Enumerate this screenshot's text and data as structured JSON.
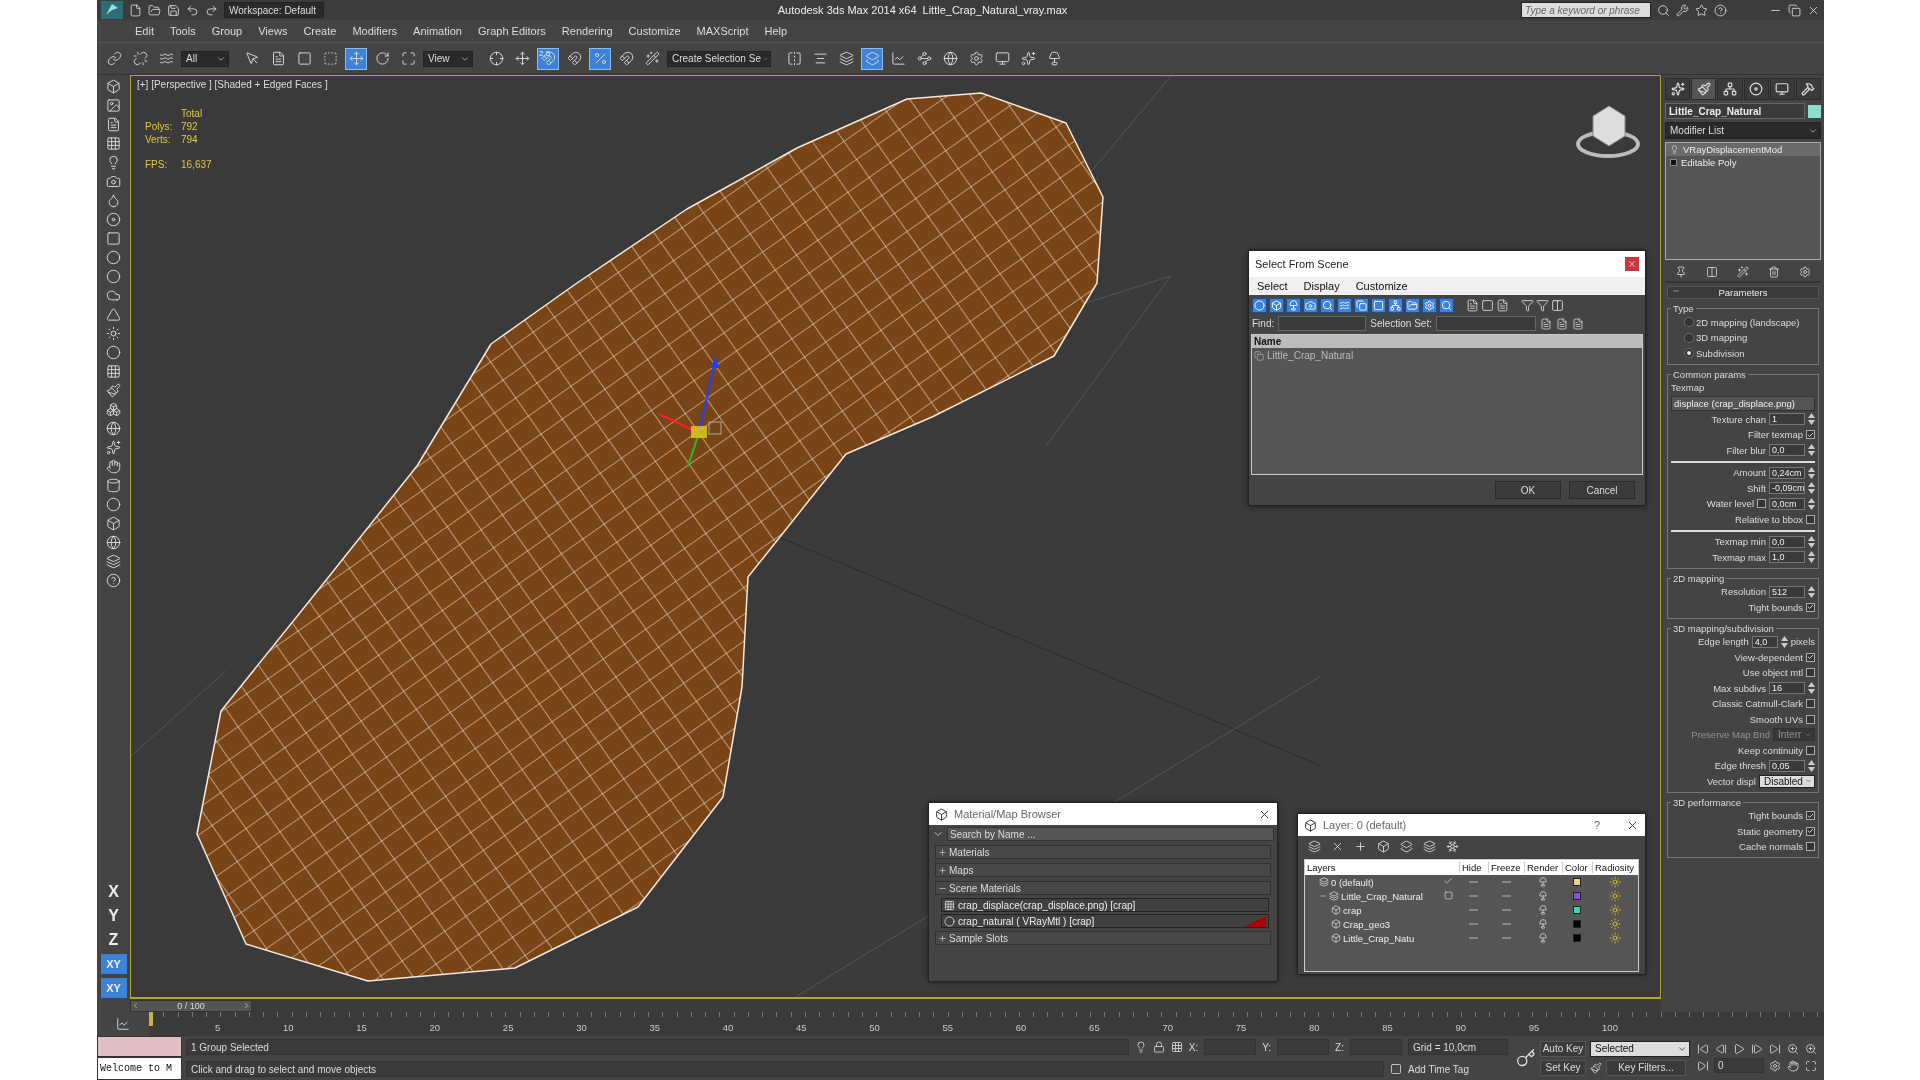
{
  "title_bar": {
    "workspace": "Workspace: Default",
    "app_title": "Autodesk 3ds Max  2014 x64",
    "file_name": "Little_Crap_Natural_vray.max",
    "search": {
      "placeholder": "Type a keyword or phrase"
    }
  },
  "menu": [
    "Edit",
    "Tools",
    "Group",
    "Views",
    "Create",
    "Modifiers",
    "Animation",
    "Graph Editors",
    "Rendering",
    "Customize",
    "MAXScript",
    "Help"
  ],
  "toolbar": {
    "selection_filter": "All",
    "reference_coord": "View",
    "selection_set": "Create Selection Se",
    "snap_label": "2.5",
    "tools": [
      {
        "selected": false
      },
      {
        "selected": false
      },
      {
        "selected": false
      },
      {
        "selected": false
      },
      {
        "selected": false
      },
      {
        "selected": false
      },
      {
        "selected": false
      },
      {
        "selected": true
      },
      {
        "selected": false
      },
      {
        "selected": false
      },
      {
        "selected": false
      },
      {
        "selected": false
      },
      {
        "selected": true
      },
      {
        "selected": false
      },
      {
        "selected": true
      },
      {
        "selected": false
      },
      {
        "selected": false
      },
      {
        "selected": false
      },
      {
        "selected": false
      },
      {
        "selected": false
      },
      {
        "selected": true
      },
      {
        "selected": false
      },
      {
        "selected": false
      },
      {
        "selected": false
      },
      {
        "selected": false
      },
      {
        "selected": false
      },
      {
        "selected": false
      },
      {
        "selected": false
      }
    ]
  },
  "left_toolbar": {
    "axes": [
      {
        "label": "X",
        "selected": false
      },
      {
        "label": "Y",
        "selected": false
      },
      {
        "label": "Z",
        "selected": false
      },
      {
        "label": "XY",
        "selected": true
      },
      {
        "label": "XY",
        "selected": true
      }
    ]
  },
  "viewport": {
    "label": "[+] [Perspective ] [Shaded + Edged Faces ]",
    "stats": {
      "header": "Total",
      "rows": [
        {
          "name": "Polys:",
          "value": "792"
        },
        {
          "name": "Verts:",
          "value": "794"
        }
      ],
      "fps_label": "FPS:",
      "fps": "16,637"
    }
  },
  "select_from_scene": {
    "title": "Select From Scene",
    "menu": [
      "Select",
      "Display",
      "Customize"
    ],
    "filters": [
      {
        "on": true
      },
      {
        "on": true
      },
      {
        "on": true
      },
      {
        "on": true
      },
      {
        "on": true
      },
      {
        "on": true
      },
      {
        "on": true
      },
      {
        "on": true
      },
      {
        "on": true
      },
      {
        "on": true
      },
      {
        "on": true
      },
      {
        "on": true
      }
    ],
    "find_label": "Find:",
    "selection_set_label": "Selection Set:",
    "column": "Name",
    "rows": [
      {
        "name": "Little_Crap_Natural",
        "selected": false
      }
    ],
    "buttons": [
      "OK",
      "Cancel"
    ]
  },
  "material_browser": {
    "title": "Material/Map Browser",
    "search": {
      "placeholder": "Search by Name ..."
    },
    "sections": [
      {
        "label": "Materials",
        "expanded": false
      },
      {
        "label": "Maps",
        "expanded": false
      },
      {
        "label": "Scene Materials",
        "expanded": true,
        "items": [
          {
            "label": "crap_displace(crap_displace.png) [crap]",
            "kind": "map",
            "shown_in_viewport": false
          },
          {
            "label": "crap_natural  ( VRayMtl ) [crap]",
            "kind": "material",
            "shown_in_viewport": true
          }
        ]
      },
      {
        "label": "Sample Slots",
        "expanded": false
      }
    ]
  },
  "layer_dialog": {
    "title": "Layer: 0 (default)",
    "help": "?",
    "columns": [
      "Layers",
      "Hide",
      "Freeze",
      "Render",
      "Color",
      "Radiosity"
    ],
    "layers": [
      {
        "name": "0 (default)",
        "current": true,
        "color": "#e6d48c"
      },
      {
        "name": "Little_Crap_Natural",
        "current": false,
        "expanded": true,
        "color": "#8a4fe0",
        "children": [
          {
            "name": "crap",
            "color": "#3fd6b4"
          },
          {
            "name": "Crap_geo3",
            "color": "#000000"
          },
          {
            "name": "Little_Crap_Natu",
            "color": "#000000"
          }
        ]
      }
    ]
  },
  "command_panel": {
    "tabs": [
      {
        "selected": false
      },
      {
        "selected": true
      },
      {
        "selected": false
      },
      {
        "selected": false
      },
      {
        "selected": false
      },
      {
        "selected": false
      }
    ],
    "object_name": "Little_Crap_Natural",
    "modifier_list": "Modifier List",
    "stack": [
      {
        "label": "VRayDisplacementMod",
        "selected": true
      },
      {
        "label": "Editable Poly",
        "selected": false
      }
    ],
    "rollout": {
      "title": "Parameters",
      "expanded": true,
      "groups": [
        {
          "title": "Type",
          "rows": [
            {
              "kind": "radio",
              "label": "2D mapping (landscape)",
              "selected": false
            },
            {
              "kind": "radio",
              "label": "3D mapping",
              "selected": false
            },
            {
              "kind": "radio",
              "label": "Subdivision",
              "selected": true
            }
          ]
        },
        {
          "title": "Common params",
          "rows": [
            {
              "kind": "text",
              "label": "Texmap"
            },
            {
              "kind": "button",
              "label": "displace (crap_displace.png)"
            },
            {
              "kind": "spinner",
              "label": "Texture chan",
              "value": "1"
            },
            {
              "kind": "checkbox",
              "label": "Filter texmap",
              "checked": true
            },
            {
              "kind": "spinner",
              "label": "Filter blur",
              "value": "0,0"
            },
            {
              "kind": "rule"
            },
            {
              "kind": "spinner",
              "label": "Amount",
              "value": "0,24cm"
            },
            {
              "kind": "spinner",
              "label": "Shift",
              "value": "-0,09cm"
            },
            {
              "kind": "spinner",
              "label": "Water level",
              "value": "0,0cm",
              "checked": false
            },
            {
              "kind": "checkbox",
              "label": "Relative to bbox",
              "checked": false
            },
            {
              "kind": "rule"
            },
            {
              "kind": "spinner",
              "label": "Texmap min",
              "value": "0,0"
            },
            {
              "kind": "spinner",
              "label": "Texmap max",
              "value": "1,0"
            }
          ]
        },
        {
          "title": "2D mapping",
          "rows": [
            {
              "kind": "spinner",
              "label": "Resolution",
              "value": "512"
            },
            {
              "kind": "checkbox",
              "label": "Tight bounds",
              "checked": true
            }
          ]
        },
        {
          "title": "3D mapping/subdivision",
          "rows": [
            {
              "kind": "spinner",
              "label": "Edge length",
              "value": "4,0",
              "unit": "pixels"
            },
            {
              "kind": "checkbox",
              "label": "View-dependent",
              "checked": true
            },
            {
              "kind": "checkbox",
              "label": "Use object mtl",
              "checked": false
            },
            {
              "kind": "spinner",
              "label": "Max subdivs",
              "value": "16"
            },
            {
              "kind": "checkbox",
              "label": "Classic Catmull-Clark",
              "checked": false
            },
            {
              "kind": "checkbox",
              "label": "Smooth UVs",
              "checked": false
            },
            {
              "kind": "dropdown",
              "label": "Preserve Map Bnd",
              "value": "Interr",
              "disabled": true
            },
            {
              "kind": "checkbox",
              "label": "Keep continuity",
              "checked": false
            },
            {
              "kind": "spinner",
              "label": "Edge thresh",
              "value": "0,05"
            },
            {
              "kind": "dropdown",
              "label": "Vector displ",
              "value": "Disabled",
              "disabled": false
            }
          ]
        },
        {
          "title": "3D performance",
          "rows": [
            {
              "kind": "checkbox",
              "label": "Tight bounds",
              "checked": true
            },
            {
              "kind": "checkbox",
              "label": "Static geometry",
              "checked": true
            },
            {
              "kind": "checkbox",
              "label": "Cache normals",
              "checked": false
            }
          ]
        }
      ]
    }
  },
  "timeline": {
    "position": "0 / 100",
    "ruler": [
      "5",
      "10",
      "15",
      "20",
      "25",
      "30",
      "35",
      "40",
      "45",
      "50",
      "55",
      "60",
      "65",
      "70",
      "75",
      "80",
      "85",
      "90",
      "95",
      "100"
    ]
  },
  "status_bar": {
    "script_field": "Welcome to M",
    "selection": "1 Group Selected",
    "prompt": "Click and drag to select and move objects",
    "x_label": "X:",
    "y_label": "Y:",
    "z_label": "Z:",
    "grid": "Grid = 10,0cm",
    "add_time_tag": "Add Time Tag",
    "auto_key": "Auto Key",
    "key_mode": "Selected",
    "set_key": "Set Key",
    "key_filters": "Key Filters...",
    "frame": "0"
  }
}
